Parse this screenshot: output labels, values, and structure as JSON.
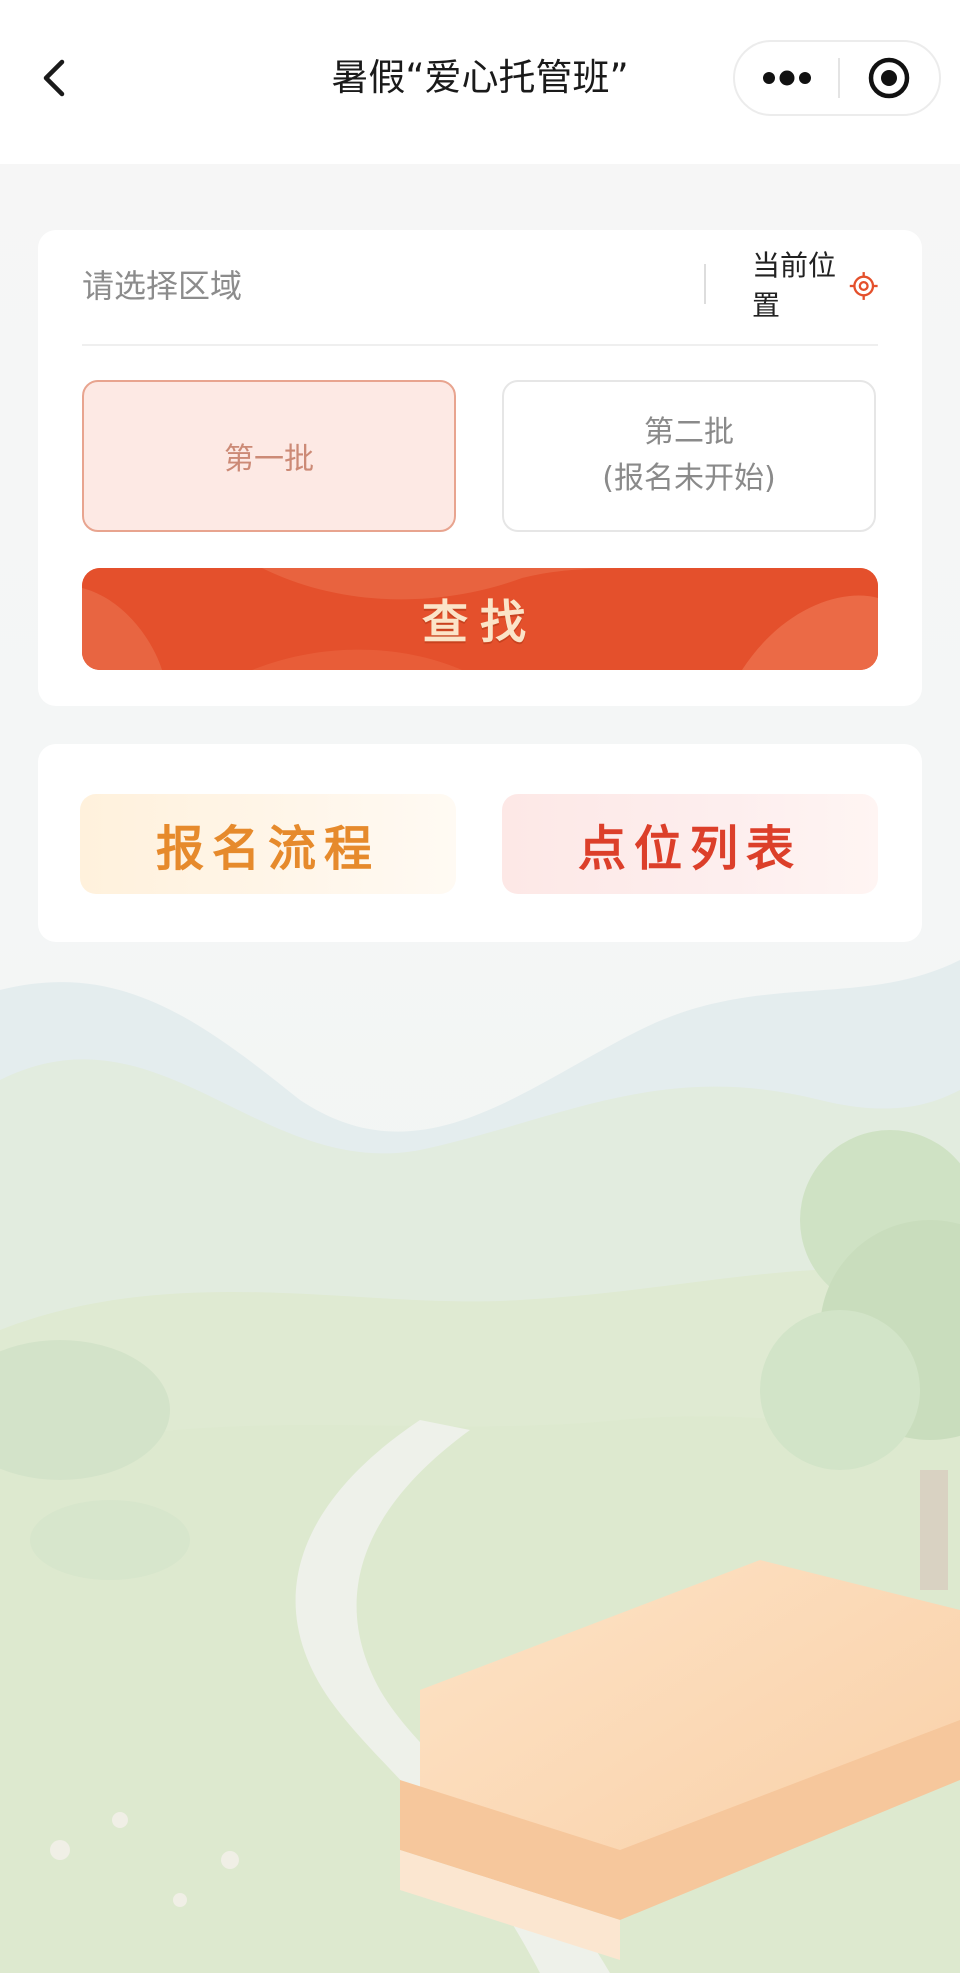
{
  "nav": {
    "title": "暑假“爱心托管班”"
  },
  "region": {
    "placeholder": "请选择区域",
    "current_location_label": "当前位置"
  },
  "batches": [
    {
      "label": "第一批",
      "note": "",
      "selected": true
    },
    {
      "label": "第二批",
      "note": "(报名未开始)",
      "selected": false
    }
  ],
  "search_button": {
    "label": "查找"
  },
  "shortcuts": {
    "process_label": "报名流程",
    "sites_label": "点位列表"
  },
  "colors": {
    "accent": "#e4502c",
    "selected_batch_bg": "#fde9e4",
    "process_text": "#e68a2c",
    "sites_text": "#dc3f2a"
  },
  "icons": {
    "back": "chevron-left-icon",
    "more": "more-dots-icon",
    "close": "target-circle-icon",
    "location": "location-crosshair-icon"
  }
}
